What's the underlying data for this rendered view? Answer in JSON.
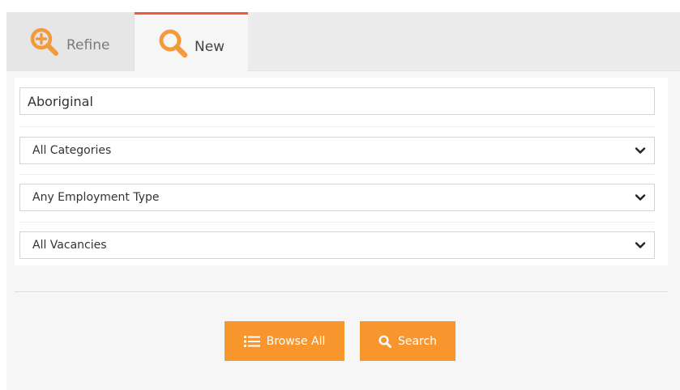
{
  "tabs": {
    "refine": {
      "label": "Refine",
      "icon": "zoom-in-icon"
    },
    "new": {
      "label": "New",
      "icon": "search-icon"
    }
  },
  "search": {
    "keyword_value": "Aboriginal",
    "category_selected": "All Categories",
    "employment_type_selected": "Any Employment Type",
    "vacancies_selected": "All Vacancies"
  },
  "actions": {
    "browse_all_label": "Browse All",
    "search_label": "Search"
  },
  "colors": {
    "accent_orange": "#f7962d",
    "active_tab_border": "#ee5a37",
    "text_dark": "#333333"
  }
}
